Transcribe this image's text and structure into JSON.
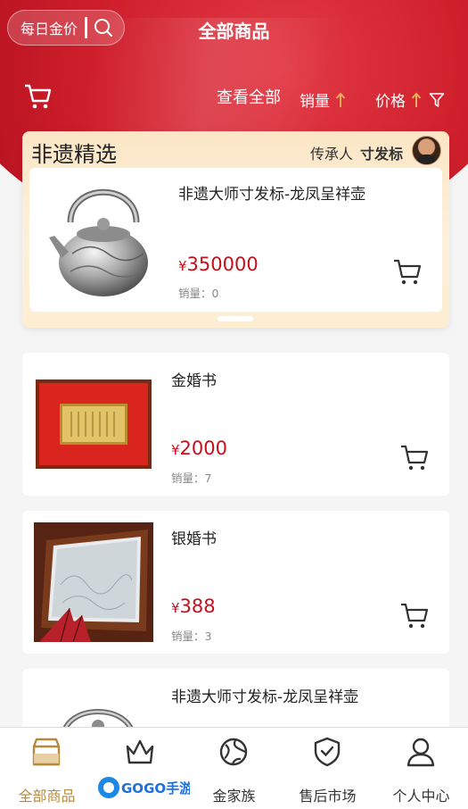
{
  "header": {
    "gold_price_label": "每日金价",
    "title": "全部商品",
    "view_all": "查看全部",
    "sort_sales": "销量",
    "sort_price": "价格"
  },
  "featured": {
    "section_title": "非遗精选",
    "inheritor_label": "传承人",
    "inheritor_name": "寸发标",
    "product": {
      "name": "非遗大师寸发标-龙凤呈祥壶",
      "currency": "¥",
      "price": "350000",
      "sales": "销量：0"
    }
  },
  "products": [
    {
      "name": "金婚书",
      "currency": "¥",
      "price": "2000",
      "sales": "销量：7"
    },
    {
      "name": "银婚书",
      "currency": "¥",
      "price": "388",
      "sales": "销量：3"
    },
    {
      "name": "非遗大师寸发标-龙凤呈祥壶"
    }
  ],
  "tabbar": {
    "items": [
      {
        "label": "全部商品",
        "icon": "shop-icon"
      },
      {
        "label": "",
        "icon": "crown-icon"
      },
      {
        "label": "金家族",
        "icon": "globe-icon"
      },
      {
        "label": "售后市场",
        "icon": "shield-check-icon"
      },
      {
        "label": "个人中心",
        "icon": "user-icon"
      }
    ]
  },
  "watermark": {
    "text": "GOGO手游网"
  },
  "colors": {
    "brand_red": "#c8101d",
    "gold_accent": "#b58a3c",
    "arrow_gold": "#e7b15a"
  }
}
